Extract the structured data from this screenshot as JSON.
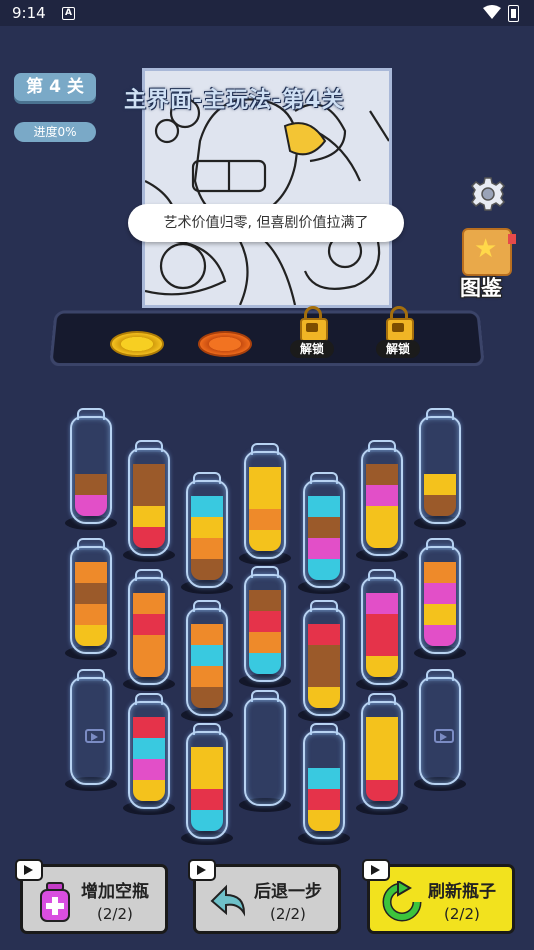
{
  "status": {
    "time": "9:14",
    "a_badge": "A"
  },
  "level": {
    "badge": "第 4 关",
    "progress": "进度0%",
    "title": "主界面-主玩法-第4关"
  },
  "speech": "艺术价值归零, 但喜剧价值拉满了",
  "sidebar": {
    "book_label": "图鉴"
  },
  "shelf": {
    "unlock_label_1": "解锁",
    "unlock_label_2": "解锁"
  },
  "colors": {
    "brown": "#9b5a2a",
    "pink": "#e24fc8",
    "yellow": "#f4c21c",
    "red": "#e5334a",
    "orange": "#ee8a2a",
    "cyan": "#39c9e0",
    "magenta": "#e24fc8"
  },
  "bottles": [
    {
      "layers": [
        "pink",
        "brown"
      ]
    },
    {
      "layers": [
        "red",
        "yellow",
        "brown",
        "brown"
      ]
    },
    {
      "layers": [
        "brown",
        "orange",
        "yellow",
        "cyan"
      ]
    },
    {
      "layers": [
        "yellow",
        "orange",
        "yellow",
        "yellow"
      ]
    },
    {
      "layers": [
        "cyan",
        "pink",
        "brown",
        "cyan"
      ]
    },
    {
      "layers": [
        "yellow",
        "yellow",
        "pink",
        "brown"
      ]
    },
    {
      "layers": [
        "brown",
        "yellow"
      ]
    },
    {
      "layers": [
        "yellow",
        "orange",
        "brown",
        "orange"
      ]
    },
    {
      "layers": [
        "orange",
        "orange",
        "red",
        "orange"
      ]
    },
    {
      "layers": [
        "brown",
        "orange",
        "cyan",
        "orange"
      ]
    },
    {
      "layers": [
        "cyan",
        "orange",
        "red",
        "brown"
      ]
    },
    {
      "layers": [
        "yellow",
        "brown",
        "brown",
        "red"
      ]
    },
    {
      "layers": [
        "yellow",
        "red",
        "red",
        "pink"
      ]
    },
    {
      "layers": [
        "pink",
        "yellow",
        "pink",
        "orange"
      ]
    },
    {
      "layers": []
    },
    {
      "layers": [
        "yellow",
        "pink",
        "cyan",
        "red"
      ]
    },
    {
      "layers": [
        "cyan",
        "red",
        "yellow",
        "yellow"
      ]
    },
    {
      "layers": []
    },
    {
      "layers": [
        "yellow",
        "red",
        "cyan"
      ]
    },
    {
      "layers": [
        "red",
        "yellow",
        "yellow",
        "yellow"
      ]
    },
    {
      "layers": []
    }
  ],
  "buttons": [
    {
      "label": "增加空瓶",
      "count": "(2/2)"
    },
    {
      "label": "后退一步",
      "count": "(2/2)"
    },
    {
      "label": "刷新瓶子",
      "count": "(2/2)"
    }
  ]
}
